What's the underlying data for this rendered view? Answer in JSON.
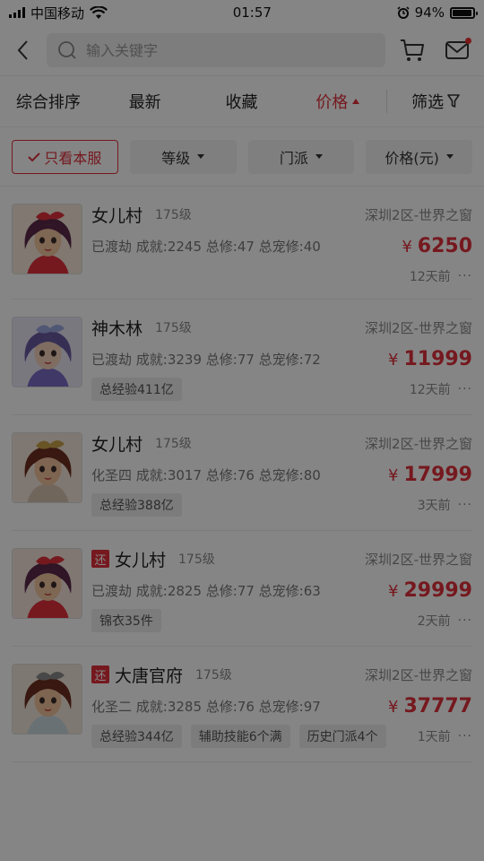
{
  "status_bar": {
    "carrier": "中国移动",
    "time": "01:57",
    "battery": "94%",
    "battery_level": 0.94
  },
  "search": {
    "placeholder": "输入关键字"
  },
  "tabs": [
    {
      "label": "综合排序"
    },
    {
      "label": "最新"
    },
    {
      "label": "收藏"
    },
    {
      "label": "价格"
    },
    {
      "label": "筛选"
    }
  ],
  "chips": {
    "only_server": "只看本服",
    "level": "等级",
    "school": "门派",
    "price": "价格(元)"
  },
  "currency": "¥",
  "listings": [
    {
      "name": "女儿村",
      "level": "175级",
      "server": "深圳2区-世界之窗",
      "stats": "已渡劫 成就:2245 总修:47 总宠修:40",
      "price": "6250",
      "tags": [],
      "time": "12天前",
      "returned": false
    },
    {
      "name": "神木林",
      "level": "175级",
      "server": "深圳2区-世界之窗",
      "stats": "已渡劫 成就:3239 总修:77 总宠修:72",
      "price": "11999",
      "tags": [
        "总经验411亿"
      ],
      "time": "12天前",
      "returned": false
    },
    {
      "name": "女儿村",
      "level": "175级",
      "server": "深圳2区-世界之窗",
      "stats": "化圣四 成就:3017 总修:76 总宠修:80",
      "price": "17999",
      "tags": [
        "总经验388亿"
      ],
      "time": "3天前",
      "returned": false
    },
    {
      "name": "女儿村",
      "level": "175级",
      "server": "深圳2区-世界之窗",
      "stats": "已渡劫 成就:2825 总修:77 总宠修:63",
      "price": "29999",
      "tags": [
        "锦衣35件"
      ],
      "time": "2天前",
      "returned": true,
      "returned_label": "还"
    },
    {
      "name": "大唐官府",
      "level": "175级",
      "server": "深圳2区-世界之窗",
      "stats": "化圣二 成就:3285 总修:76 总宠修:97",
      "price": "37777",
      "tags": [
        "总经验344亿",
        "辅助技能6个满",
        "历史门派4个"
      ],
      "time": "1天前",
      "returned": true,
      "returned_label": "还"
    }
  ],
  "colors": {
    "accent": "#e0313c",
    "overlay": "rgba(0,0,0,0.48)"
  }
}
